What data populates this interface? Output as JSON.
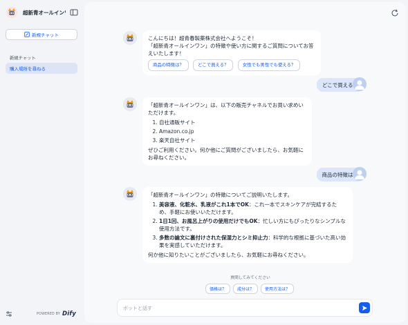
{
  "app": {
    "name": "超新青オールインワ...",
    "new_chat_label": "新規チャット"
  },
  "sidebar": {
    "section_label": "新規チャット",
    "conversations": [
      {
        "label": "購入場所を尋ねる",
        "active": true
      }
    ],
    "footer": {
      "powered_by": "POWERED BY",
      "brand": "Dify"
    }
  },
  "chat": {
    "messages": [
      {
        "role": "bot",
        "lines": [
          "こんにちは！超青春製薬株式会社へようこそ！",
          "「超新青オールインワン」の特徴や使い方に関するご質問についてお答えいたします！"
        ],
        "suggestions": [
          "商品の特徴は？",
          "どこで買える？",
          "女性でも男性でも使える？"
        ]
      },
      {
        "role": "user",
        "text": "どこで買える？"
      },
      {
        "role": "bot",
        "intro": "「超新青オールインワン」は、以下の販売チャネルでお買い求めいただけます。",
        "items": [
          "自社通販サイト",
          "Amazon.co.jp",
          "楽天自社サイト"
        ],
        "outro": "ぜひご利用ください。何か他にご質問がございましたら、お気軽にお尋ねください。"
      },
      {
        "role": "user",
        "text": "商品の特徴は？"
      },
      {
        "role": "bot",
        "intro": "「超新青オールインワン」の特徴についてご説明いたします。",
        "items": [
          {
            "bold": "美容液、化粧水、乳液がこれ1本でOK",
            "text": "：これ一本でスキンケアが完結するため、手軽にお使いいただけます。"
          },
          {
            "bold": "1日1回、お風呂上がりの使用だけでもOK",
            "text": "：忙しい方にもぴったりなシンプルな使用方法です。"
          },
          {
            "bold": "多数の論文に裏付けされた保湿力とシミ抑止力",
            "text": "：科学的な根拠に基づいた高い効果を実感していただけます。"
          }
        ],
        "outro": "何か他に知りたいことがございましたら、お気軽にお尋ねください。"
      }
    ],
    "suggest_label": "質問してみてください",
    "suggest_chips": [
      "価格は？",
      "成分は？",
      "使用方法は？"
    ],
    "input_placeholder": "ボットと話す"
  },
  "colors": {
    "accent": "#155eef",
    "user_bubble": "#dbe6fb",
    "sidebar_bg": "#f2f4f7",
    "active_item_bg": "#dde4f5"
  }
}
